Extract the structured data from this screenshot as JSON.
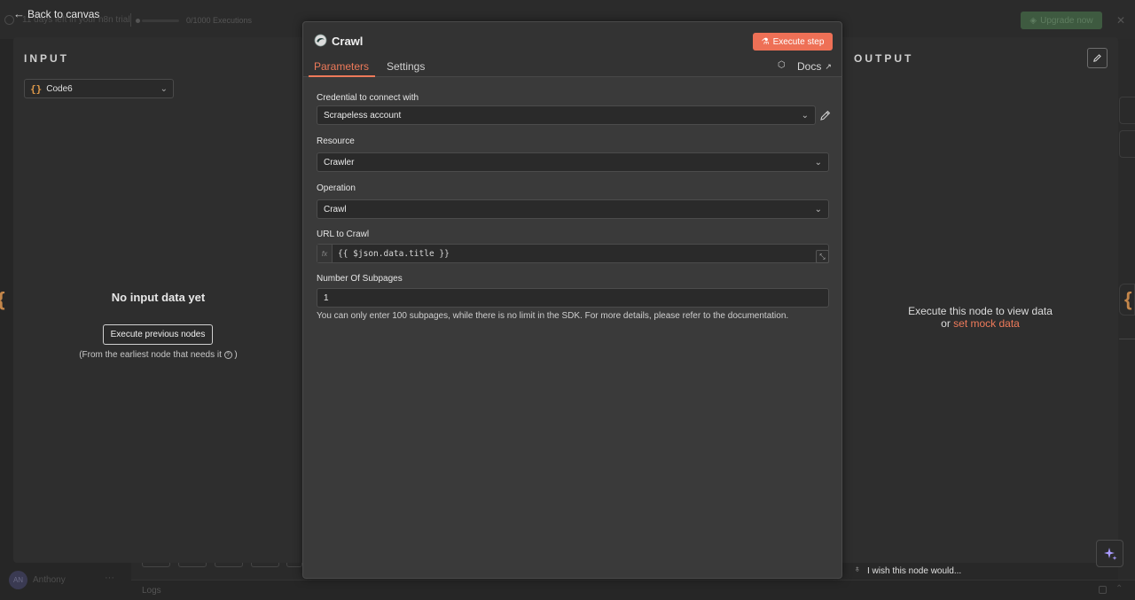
{
  "background": {
    "trial_text": "11 days left in your n8n trial",
    "executions": "0/1000 Executions",
    "upgrade_label": "Upgrade now",
    "user_initials": "AN",
    "user_name": "Anthony",
    "logs_label": "Logs"
  },
  "back_label": "Back to canvas",
  "input_panel": {
    "title": "INPUT",
    "selected_node": "Code6",
    "empty_title": "No input data yet",
    "execute_previous_label": "Execute previous nodes",
    "note_before": "(From the earliest node that needs it",
    "note_after": ")"
  },
  "modal": {
    "title": "Crawl",
    "execute_label": "Execute step",
    "tabs": [
      "Parameters",
      "Settings"
    ],
    "docs_label": "Docs",
    "credential": {
      "label": "Credential to connect with",
      "value": "Scrapeless account"
    },
    "resource": {
      "label": "Resource",
      "value": "Crawler"
    },
    "operation": {
      "label": "Operation",
      "value": "Crawl"
    },
    "url": {
      "label": "URL to Crawl",
      "fx": "fx",
      "value": "{{ $json.data.title }}"
    },
    "subpages": {
      "label": "Number Of Subpages",
      "value": "1"
    },
    "hint": "You can only enter 100 subpages, while there is no limit in the SDK. For more details, please refer to the documentation."
  },
  "output_panel": {
    "title": "OUTPUT",
    "message_line1": "Execute this node to view data",
    "message_or": "or",
    "mock_link": "set mock data",
    "wish_text": "I wish this node would..."
  },
  "colors": {
    "accent": "#ee7056",
    "accent_text": "#ee7a5a",
    "upgrade_green": "#3e5a40",
    "code_icon": "#e09a4a"
  }
}
